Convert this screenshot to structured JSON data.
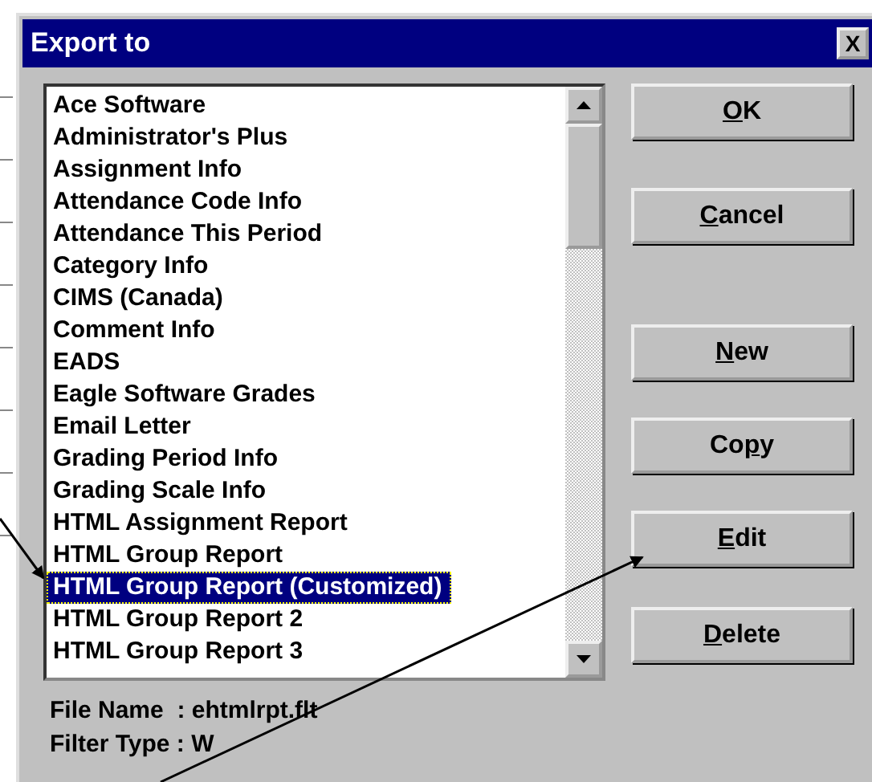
{
  "window": {
    "title": "Export to",
    "close": "X"
  },
  "list": {
    "items": [
      {
        "label": "Ace Software",
        "selected": false
      },
      {
        "label": "Administrator's Plus",
        "selected": false
      },
      {
        "label": "Assignment Info",
        "selected": false
      },
      {
        "label": "Attendance Code Info",
        "selected": false
      },
      {
        "label": "Attendance This Period",
        "selected": false
      },
      {
        "label": "Category Info",
        "selected": false
      },
      {
        "label": "CIMS (Canada)",
        "selected": false
      },
      {
        "label": "Comment Info",
        "selected": false
      },
      {
        "label": "EADS",
        "selected": false
      },
      {
        "label": "Eagle Software Grades",
        "selected": false
      },
      {
        "label": "Email Letter",
        "selected": false
      },
      {
        "label": "Grading Period Info",
        "selected": false
      },
      {
        "label": "Grading Scale Info",
        "selected": false
      },
      {
        "label": "HTML Assignment Report",
        "selected": false
      },
      {
        "label": "HTML Group Report",
        "selected": false
      },
      {
        "label": "HTML Group Report (Customized)",
        "selected": true
      },
      {
        "label": "HTML Group Report 2",
        "selected": false
      },
      {
        "label": "HTML Group Report 3",
        "selected": false
      }
    ]
  },
  "buttons": [
    {
      "key": "O",
      "post": "K"
    },
    {
      "key": "C",
      "post": "ancel"
    },
    {
      "key": "N",
      "post": "ew"
    },
    {
      "pre": "Co",
      "key": "p",
      "post": "y"
    },
    {
      "key": "E",
      "post": "dit"
    },
    {
      "key": "D",
      "post": "elete"
    }
  ],
  "info": [
    "File Name  : ehtmlrpt.flt",
    "Filter Type : W"
  ]
}
